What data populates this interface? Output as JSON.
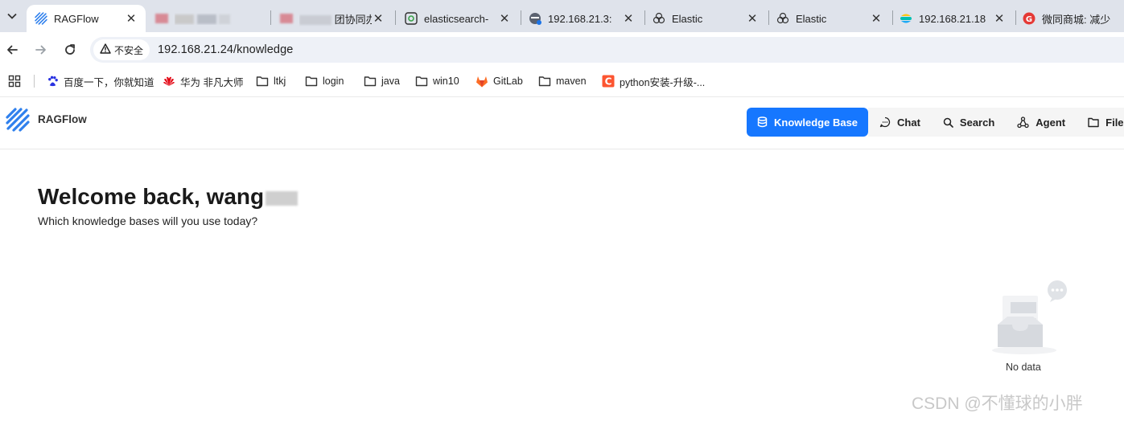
{
  "browser": {
    "tabs": [
      {
        "title": "RAGFlow",
        "active": true,
        "favicon": "ragflow-logo-icon"
      },
      {
        "title": "",
        "active": false,
        "favicon": "blurred-icon"
      },
      {
        "title": "团协同办",
        "active": false,
        "favicon": "blurred-icon"
      },
      {
        "title": "elasticsearch-",
        "active": false,
        "favicon": "gitee-icon"
      },
      {
        "title": "192.168.21.3:",
        "active": false,
        "favicon": "elastic-server-icon"
      },
      {
        "title": "Elastic",
        "active": false,
        "favicon": "elastic-flower-icon"
      },
      {
        "title": "Elastic",
        "active": false,
        "favicon": "elastic-flower-icon"
      },
      {
        "title": "192.168.21.18",
        "active": false,
        "favicon": "elastic-logo-icon"
      },
      {
        "title": "微同商城: 减少",
        "active": false,
        "favicon": "g-logo-icon"
      }
    ],
    "tab_close_glyph": "✕",
    "security_label": "不安全",
    "url": "192.168.21.24/knowledge",
    "bookmarks": [
      {
        "label": "百度一下，你就知道",
        "icon": "baidu-paw-icon"
      },
      {
        "label": "华为 非凡大师",
        "icon": "huawei-logo-icon"
      },
      {
        "label": "ltkj",
        "icon": "folder-icon"
      },
      {
        "label": "login",
        "icon": "folder-icon"
      },
      {
        "label": "java",
        "icon": "folder-icon"
      },
      {
        "label": "win10",
        "icon": "folder-icon"
      },
      {
        "label": "GitLab",
        "icon": "gitlab-icon"
      },
      {
        "label": "maven",
        "icon": "folder-icon"
      },
      {
        "label": "python安装-升级-...",
        "icon": "csdn-c-icon"
      }
    ]
  },
  "app": {
    "brand": "RAGFlow",
    "nav": [
      {
        "label": "Knowledge Base",
        "icon": "database-icon",
        "active": true
      },
      {
        "label": "Chat",
        "icon": "chat-bubble-icon",
        "active": false
      },
      {
        "label": "Search",
        "icon": "search-icon",
        "active": false
      },
      {
        "label": "Agent",
        "icon": "agent-graph-icon",
        "active": false
      },
      {
        "label": "File M",
        "icon": "folder-icon",
        "active": false
      }
    ],
    "colors": {
      "accent": "#1677ff"
    }
  },
  "main": {
    "welcome": "Welcome back, wang",
    "subtitle": "Which knowledge bases will you use today?",
    "empty_text": "No data"
  },
  "watermark": "CSDN @不懂球的小胖"
}
